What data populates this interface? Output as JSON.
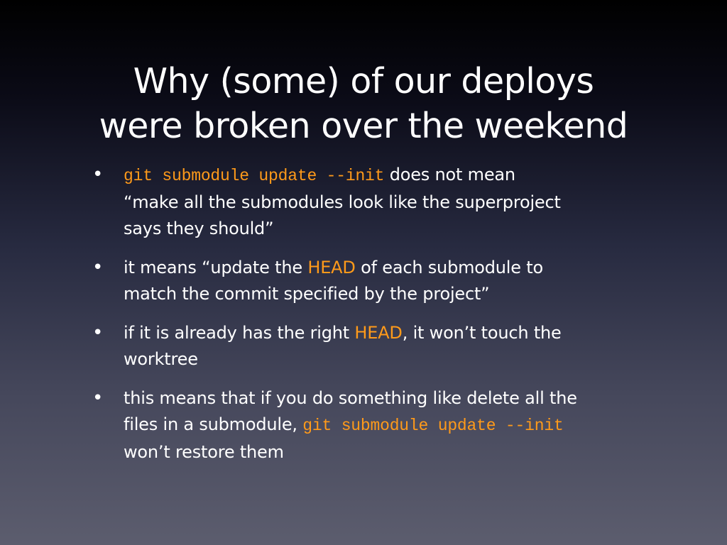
{
  "title": {
    "line1": "Why (some) of our deploys",
    "line2": "were broken over the weekend"
  },
  "bullets": [
    {
      "l1_code": "git submodule update --init",
      "l1_text": " does not mean",
      "l2": "“make all the submodules look like the superproject",
      "l3": "says they should”"
    },
    {
      "l1_pre": "it means “update the ",
      "l1_hl": "HEAD",
      "l1_post": " of each submodule to",
      "l2": "match the commit specified by the project”"
    },
    {
      "l1_pre": "if it is already has the right ",
      "l1_hl": "HEAD",
      "l1_post": ", it won’t touch the",
      "l2": "worktree"
    },
    {
      "l1": "this means that if you do something like delete all the",
      "l2_pre": "files in a submodule, ",
      "l2_code": "git submodule update --init",
      "l3": "won’t restore them"
    }
  ],
  "bullet_glyph": "•",
  "colors": {
    "accent": "#ff9a1a",
    "text": "#ffffff"
  }
}
